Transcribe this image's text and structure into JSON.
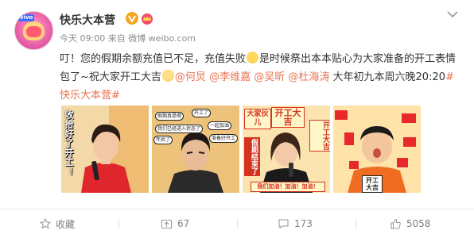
{
  "post": {
    "author": "快乐大本营",
    "meta": "今天 09:00 来自 微博 weibo.com",
    "text_parts": [
      {
        "type": "text",
        "value": "叮！您的假期余额充值已不足，充值失败"
      },
      {
        "type": "emoji",
        "name": "cry-emoji"
      },
      {
        "type": "text",
        "value": "是时候祭出本本贴心为大家准备的开工表情包了~祝大家开工大吉"
      },
      {
        "type": "emoji",
        "name": "pray-emoji"
      },
      {
        "type": "link",
        "value": "@何炅"
      },
      {
        "type": "text",
        "value": " "
      },
      {
        "type": "link",
        "value": "@李维嘉"
      },
      {
        "type": "text",
        "value": " "
      },
      {
        "type": "link",
        "value": "@吴昕"
      },
      {
        "type": "text",
        "value": " "
      },
      {
        "type": "link",
        "value": "@杜海涛"
      },
      {
        "type": "text",
        "value": " 大年初九本周六晚20:20"
      },
      {
        "type": "link",
        "value": "#快乐大本营#"
      }
    ]
  },
  "images": {
    "img1": {
      "sticker": "收拾好了开工！"
    },
    "img2": {
      "bubbles": [
        "假期真是啊",
        "开工了",
        "我们已经进入状态了",
        "一起加油",
        "年后了",
        "准备好开工"
      ]
    },
    "img3": {
      "sign_left": "大家伙儿",
      "sign_mid": "开工大吉",
      "sign_right": "开工大吉",
      "caption": "假期结束了",
      "bottom": "我们加油！加油！加油！"
    },
    "img4": {
      "sign": "开工大吉"
    }
  },
  "actions": {
    "favorite": {
      "icon": "star-icon",
      "label": "收藏"
    },
    "repost": {
      "icon": "repost-icon",
      "count": "67"
    },
    "comment": {
      "icon": "comment-icon",
      "count": "173"
    },
    "like": {
      "icon": "thumbs-up-icon",
      "count": "5058"
    }
  },
  "colors": {
    "link": "#eb7350",
    "verified": "#f6a623",
    "muted": "#808080"
  }
}
